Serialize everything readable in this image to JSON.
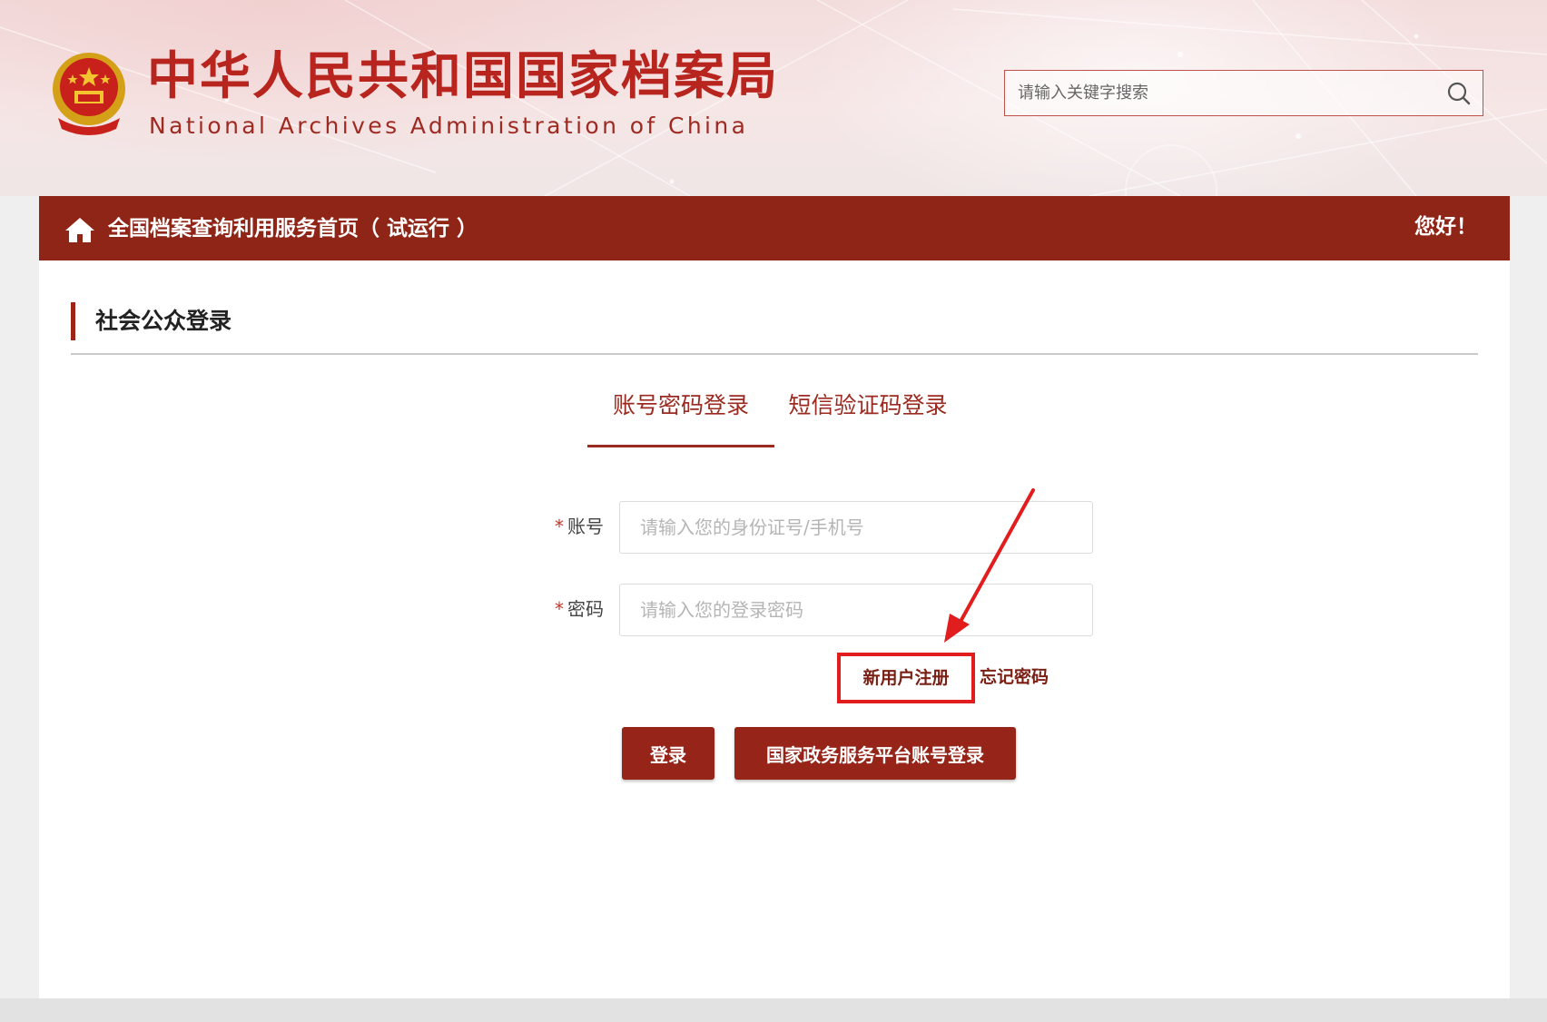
{
  "header": {
    "title_cn": "中华人民共和国国家档案局",
    "title_en": "National Archives Administration of China",
    "emblem_icon": "national-emblem-icon",
    "search": {
      "placeholder": "请输入关键字搜索",
      "value": "",
      "icon": "search-icon"
    }
  },
  "navbar": {
    "home_icon": "home-icon",
    "title": "全国档案查询利用服务首页（ 试运行 ）",
    "greeting": "您好！"
  },
  "section": {
    "title": "社会公众登录"
  },
  "tabs": [
    {
      "label": "账号密码登录",
      "active": true
    },
    {
      "label": "短信验证码登录",
      "active": false
    }
  ],
  "form": {
    "required_mark": "*",
    "account": {
      "label": "账号",
      "placeholder": "请输入您的身份证号/手机号",
      "value": ""
    },
    "password": {
      "label": "密码",
      "placeholder": "请输入您的登录密码",
      "value": ""
    },
    "register_link": "新用户注册",
    "forgot_link": "忘记密码",
    "login_button": "登录",
    "gov_login_button": "国家政务服务平台账号登录"
  },
  "colors": {
    "brand_red": "#8f2517",
    "title_red": "#b8251e",
    "annotation_red": "#e11d1d"
  }
}
